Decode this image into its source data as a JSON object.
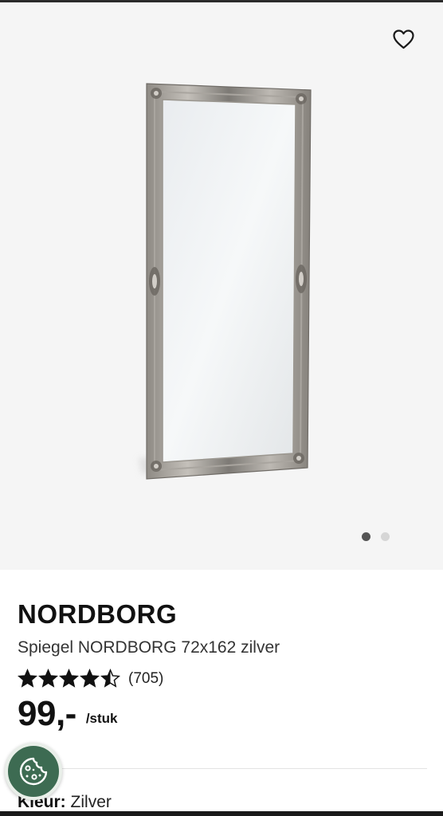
{
  "gallery": {
    "image": {
      "icon": "framed-mirror-image"
    },
    "wishlist": {
      "icon": "heart-outline-icon"
    },
    "pagination": {
      "total": 2,
      "active_index": 0
    }
  },
  "product": {
    "brand": "NORDBORG",
    "name": "Spiegel NORDBORG 72x162 zilver",
    "rating": {
      "stars": 4.5,
      "max_stars": 5,
      "count_text": "(705)"
    },
    "price": "99,-",
    "unit": "/stuk",
    "color": {
      "label": "Kleur:",
      "value": "Zilver"
    }
  },
  "cookie": {
    "icon": "cookie-icon"
  },
  "colors": {
    "gallery_bg": "#f5f5f5",
    "cookie_bg": "#3d6b52",
    "dot_active": "#555555",
    "dot_inactive": "#d6d6d6"
  }
}
